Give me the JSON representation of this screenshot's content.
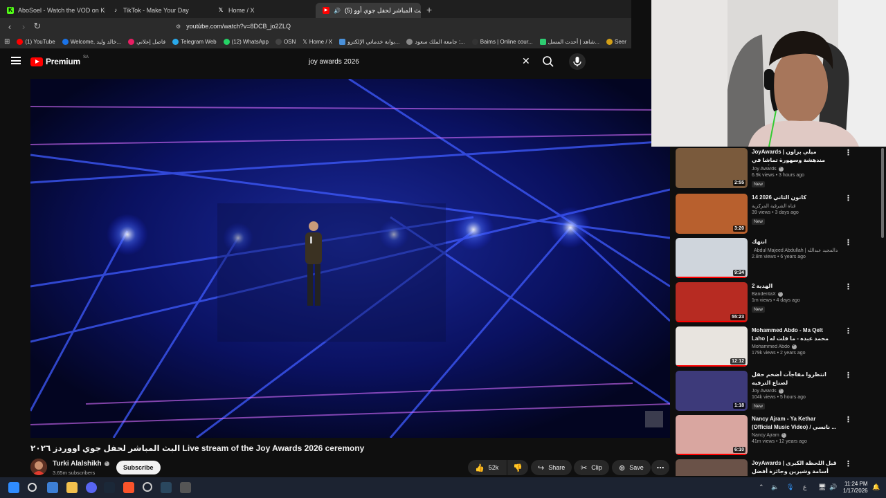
{
  "browser": {
    "tabs": [
      {
        "label": "AboSoel - Watch the VOD on Kick",
        "icon": "kick-icon",
        "color": "#53fc18",
        "active": false
      },
      {
        "label": "TikTok - Make Your Day",
        "icon": "tiktok-icon",
        "color": "#ffffff",
        "active": false
      },
      {
        "label": "Home / X",
        "icon": "x-icon",
        "color": "#ffffff",
        "active": false
      },
      {
        "label": "(5) البث المباشر لحفل جوي أوو",
        "icon": "youtube-icon",
        "color": "#ff0000",
        "active": true
      }
    ],
    "url": "youtube.com/watch?v=8DCB_jo2ZLQ",
    "bookmarks": [
      {
        "label": "(1) YouTube",
        "color": "#ff0000"
      },
      {
        "label": "Welcome, خالد وليد...",
        "color": "#1a73e8"
      },
      {
        "label": "فاصل إعلاني",
        "color": "#e91e63"
      },
      {
        "label": "Telegram Web",
        "color": "#29a9eb"
      },
      {
        "label": "(12) WhatsApp",
        "color": "#25d366"
      },
      {
        "label": "OSN",
        "color": "#222222"
      },
      {
        "label": "Home / X",
        "color": "#ffffff"
      },
      {
        "label": "بوابة خدماتي الإلكترو...",
        "color": "#4a90d9"
      },
      {
        "label": "جامعة الملك سعود :...",
        "color": "#888888"
      },
      {
        "label": "Baims | Online cour...",
        "color": "#333333"
      },
      {
        "label": "شاهد | أحدث المسل...",
        "color": "#2ecc71"
      },
      {
        "label": "Seer",
        "color": "#d4a017"
      }
    ]
  },
  "youtube": {
    "logo": "Premium",
    "region": "SA",
    "search_value": "joy awards 2026"
  },
  "video": {
    "title": "البث المباشر لحفل جوي اووردز ٢٠٢٦ Live stream of the Joy Awards 2026 ceremony",
    "channel": "Turki Alalshikh",
    "subscribers": "3.65m subscribers",
    "subscribe_label": "Subscribe",
    "likes": "52k",
    "share_label": "Share",
    "clip_label": "Clip",
    "save_label": "Save"
  },
  "sidebar": {
    "items": [
      {
        "title": "JoyAwards | ميلي براون مندهشة وسهورة تماشا في حفل جوي أووردز",
        "channel": "Joy Awards",
        "meta": "6.9k views • 3 hours ago",
        "duration": "2:55",
        "new": "New",
        "thumb": "#7a5a3c",
        "progress": 0
      },
      {
        "title": "14 كانون الثاني 2026",
        "channel": "قناة الشرقية المركزية",
        "meta": "39 views • 3 days ago",
        "duration": "3:20",
        "new": "New",
        "thumb": "#b8602e",
        "progress": 0
      },
      {
        "title": "انتهك",
        "channel": "Abdul Majeed Abdullah | عبدالمجيد عبدالله",
        "meta": "2.8m views • 6 years ago",
        "duration": "9:34",
        "new": "",
        "thumb": "#cfd5dc",
        "progress": 1
      },
      {
        "title": "الهدية 2",
        "channel": "BanderitaX",
        "meta": "1m views • 4 days ago",
        "duration": "55:23",
        "new": "New",
        "thumb": "#b72b22",
        "progress": 1
      },
      {
        "title": "Mohammed Abdo - Ma Qelt Laho | محمد عبده - ما قلت له",
        "channel": "Mohammed Abdo",
        "meta": "179k views • 2 years ago",
        "duration": "12:12",
        "new": "",
        "thumb": "#e8e4df",
        "progress": 1
      },
      {
        "title": "انتظروا مفاجآت أضخم حفل لصناع الترفيه",
        "channel": "Joy Awards",
        "meta": "104k views • 5 hours ago",
        "duration": "1:18",
        "new": "New",
        "thumb": "#3d3a7a",
        "progress": 0
      },
      {
        "title": "Nancy Ajram - Ya Kethar (Official Music Video) / نانسي ...",
        "channel": "Nancy Ajram",
        "meta": "41m views • 12 years ago",
        "duration": "6:10",
        "new": "",
        "thumb": "#d9a6a0",
        "progress": 1
      },
      {
        "title": "JoyAwards | قبل اللحظة الكبرى أسامة وشيرين وجائزة أفضل مؤثر",
        "channel": "",
        "meta": "",
        "duration": "",
        "new": "",
        "thumb": "#6a5248",
        "progress": 0
      }
    ]
  },
  "taskbar": {
    "time": "11:24 PM",
    "date": "1/17/2026",
    "lang": "ع"
  }
}
